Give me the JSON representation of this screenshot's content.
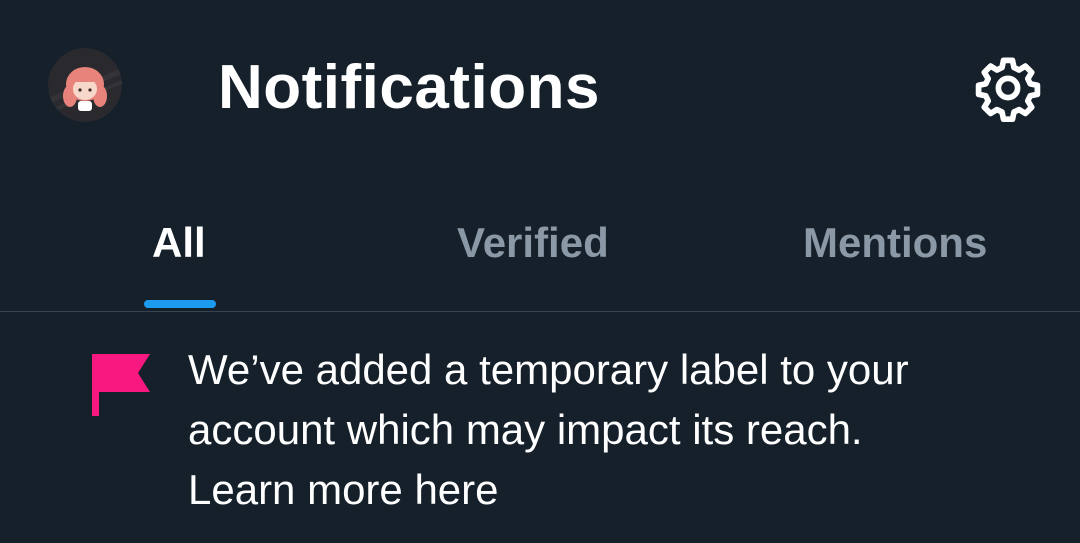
{
  "header": {
    "title": "Notifications",
    "avatar_icon": "profile-avatar",
    "settings_icon": "gear-icon"
  },
  "tabs": [
    {
      "label": "All",
      "active": true
    },
    {
      "label": "Verified",
      "active": false
    },
    {
      "label": "Mentions",
      "active": false
    }
  ],
  "notification": {
    "icon": "flag-icon",
    "lines": [
      "We’ve added a temporary label to your",
      "account which may impact its reach.",
      "Learn more here"
    ]
  },
  "colors": {
    "background": "#15202b",
    "accent": "#1d9bf0",
    "flag": "#f91880",
    "inactive_tab": "#8b98a5",
    "divider": "#38444d"
  }
}
